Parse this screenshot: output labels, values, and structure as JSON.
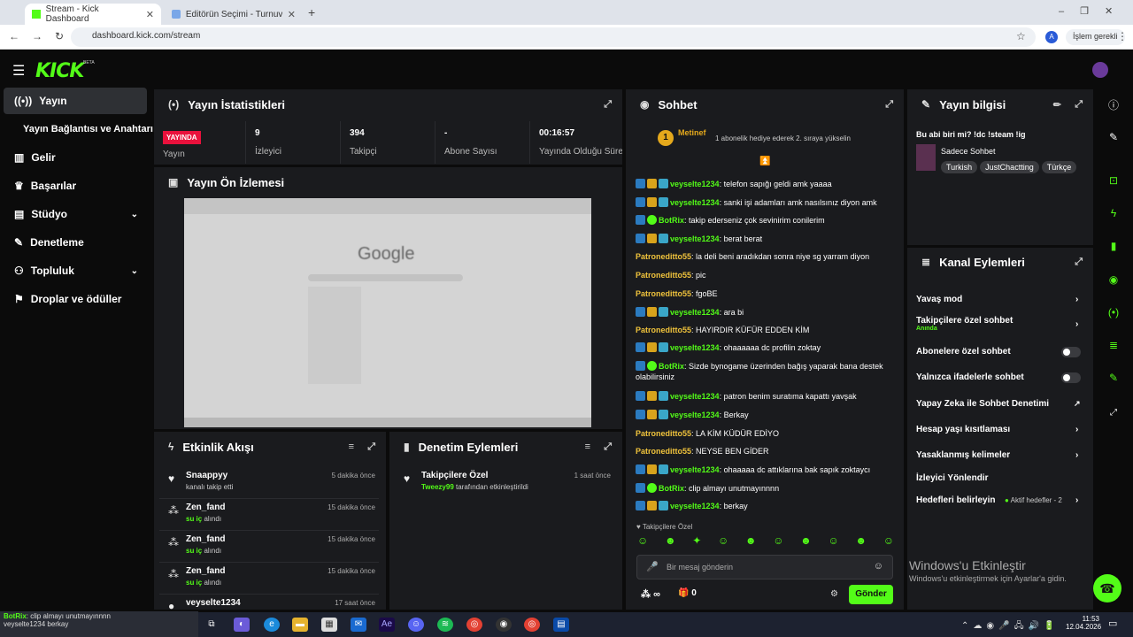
{
  "browser": {
    "tabs": [
      {
        "title": "Stream - Kick Dashboard"
      },
      {
        "title": "Editörün Seçimi - Turnuva - Qu"
      }
    ],
    "url": "dashboard.kick.com/stream",
    "profile": "A",
    "action": "İşlem gerekli"
  },
  "header": {
    "logo": "KICK",
    "beta": "BETA"
  },
  "sidebar": {
    "items": [
      {
        "label": "Yayın"
      },
      {
        "label": "Yayın Bağlantısı ve Anahtarı"
      },
      {
        "label": "Gelir"
      },
      {
        "label": "Başarılar"
      },
      {
        "label": "Stüdyo"
      },
      {
        "label": "Denetleme"
      },
      {
        "label": "Topluluk"
      },
      {
        "label": "Droplar ve ödüller"
      }
    ]
  },
  "stats": {
    "title": "Yayın İstatistikleri",
    "live_badge": "YAYINDA",
    "live_label": "Yayın",
    "viewers": {
      "value": "9",
      "label": "İzleyici"
    },
    "followers": {
      "value": "394",
      "label": "Takipçi"
    },
    "subs": {
      "value": "-",
      "label": "Abone Sayısı"
    },
    "uptime": {
      "value": "00:16:57",
      "label": "Yayında Olduğu Süre"
    }
  },
  "preview": {
    "title": "Yayın Ön İzlemesi",
    "google": "Google"
  },
  "activity": {
    "title": "Etkinlik Akışı",
    "events": [
      {
        "name": "Snaappyy",
        "sub": "kanalı takip etti",
        "time": "5 dakika önce"
      },
      {
        "name": "Zen_fand",
        "sub_hl": "su iç",
        "sub": "alındı",
        "time": "15 dakika önce"
      },
      {
        "name": "Zen_fand",
        "sub_hl": "su iç",
        "sub": "alındı",
        "time": "15 dakika önce"
      },
      {
        "name": "Zen_fand",
        "sub_hl": "su iç",
        "sub": "alındı",
        "time": "15 dakika önce"
      },
      {
        "name": "veyselte1234",
        "sub": "",
        "time": "17 saat önce"
      }
    ]
  },
  "moderation": {
    "title": "Denetim Eylemleri",
    "events": [
      {
        "name": "Takipçilere Özel",
        "user": "Tweezy99",
        "sub": "tarafından etkinleştirildi",
        "time": "1 saat önce"
      }
    ]
  },
  "chat": {
    "title": "Sohbet",
    "pinned_user": "Metinef",
    "pinned_rank": "1",
    "pinned_msg": "1 abonelik hediye ederek 2. sıraya yükselin",
    "messages": [
      {
        "user": "veyselte1234",
        "color": "#53fc18",
        "badges": 3,
        "text": "telefon sapığı geldi amk yaaaa"
      },
      {
        "user": "veyselte1234",
        "color": "#53fc18",
        "badges": 3,
        "text": "sanki işi adamları amk nasılsınız diyon amk"
      },
      {
        "user": "BotRix",
        "color": "#53fc18",
        "badges": 2,
        "text": "takip ederseniz çok sevinirim conilerim"
      },
      {
        "user": "veyselte1234",
        "color": "#53fc18",
        "badges": 3,
        "text": "berat berat"
      },
      {
        "user": "Patroneditto55",
        "color": "#f0c33c",
        "badges": 0,
        "text": "la deli beni aradıkdan sonra niye sg yarram diyon"
      },
      {
        "user": "Patroneditto55",
        "color": "#f0c33c",
        "badges": 0,
        "text": "pic"
      },
      {
        "user": "Patroneditto55",
        "color": "#f0c33c",
        "badges": 0,
        "text": "fgoBE"
      },
      {
        "user": "veyselte1234",
        "color": "#53fc18",
        "badges": 3,
        "text": "ara bi"
      },
      {
        "user": "Patroneditto55",
        "color": "#f0c33c",
        "badges": 0,
        "text": "HAYIRDIR KÜFÜR EDDEN KİM"
      },
      {
        "user": "veyselte1234",
        "color": "#53fc18",
        "badges": 3,
        "text": "ohaaaaaa dc profilin zoktay"
      },
      {
        "user": "BotRix",
        "color": "#53fc18",
        "badges": 2,
        "text": "Sizde bynogame üzerinden bağış yaparak bana destek olabilirsiniz"
      },
      {
        "user": "veyselte1234",
        "color": "#53fc18",
        "badges": 3,
        "text": "patron benim suratıma kapattı yavşak"
      },
      {
        "user": "veyselte1234",
        "color": "#53fc18",
        "badges": 3,
        "text": "Berkay"
      },
      {
        "user": "Patroneditto55",
        "color": "#f0c33c",
        "badges": 0,
        "text": "LA KİM KÜDÜR EDİYO"
      },
      {
        "user": "Patroneditto55",
        "color": "#f0c33c",
        "badges": 0,
        "text": "NEYSE BEN GİDER"
      },
      {
        "user": "veyselte1234",
        "color": "#53fc18",
        "badges": 3,
        "text": "ohaaaaa dc attıklarına bak sapık zoktaycı"
      },
      {
        "user": "BotRix",
        "color": "#53fc18",
        "badges": 2,
        "text": "clip almayı unutmayınnnn"
      },
      {
        "user": "veyselte1234",
        "color": "#53fc18",
        "badges": 3,
        "text": "berkay"
      }
    ],
    "mode_label": "Takipçilere Özel",
    "placeholder": "Bir mesaj gönderin",
    "points": "∞",
    "gift_count": "0",
    "send": "Gönder"
  },
  "info": {
    "title": "Yayın bilgisi",
    "stream_title": "Bu abi biri mi? !dc !steam !ig",
    "category": "Sadece Sohbet",
    "tags": [
      "Turkish",
      "JustChactting",
      "Türkçe"
    ]
  },
  "channel": {
    "title": "Kanal Eylemleri",
    "items": [
      {
        "label": "Yavaş mod"
      },
      {
        "label": "Takipçilere özel sohbet",
        "sub": "Anında"
      },
      {
        "label": "Abonelere özel sohbet"
      },
      {
        "label": "Yalnızca ifadelerle sohbet"
      },
      {
        "label": "Yapay Zeka ile Sohbet Denetimi"
      },
      {
        "label": "Hesap yaşı kısıtlaması"
      },
      {
        "label": "Yasaklanmış kelimeler"
      },
      {
        "label": "İzleyici Yönlendir"
      },
      {
        "label": "Hedefleri belirleyin",
        "extra": "Aktif hedefler - 2"
      }
    ]
  },
  "windows": {
    "activate_title": "Windows'u Etkinleştir",
    "activate_sub": "Windows'u etkinleştirmek için Ayarlar'a gidin.",
    "time": "11:53",
    "date": "12.04.2026",
    "popup_user": "BotRix",
    "popup_msg": "clip almayı unutmayınnnn",
    "popup2": "veyselte1234 berkay"
  }
}
